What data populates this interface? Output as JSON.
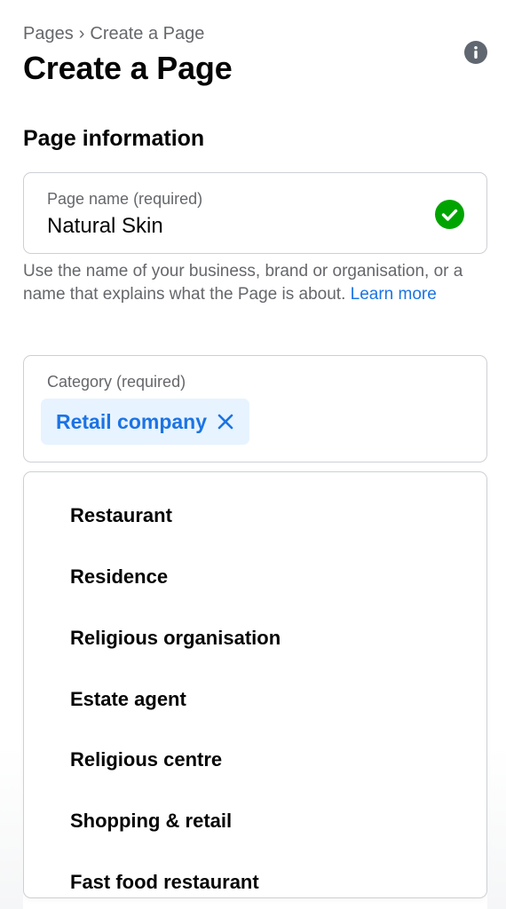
{
  "header": {
    "breadcrumb_root": "Pages",
    "breadcrumb_separator": "›",
    "breadcrumb_current": "Create a Page",
    "title": "Create a Page",
    "info_icon": "info-icon"
  },
  "section": {
    "title": "Page information"
  },
  "page_name": {
    "label": "Page name (required)",
    "value": "Natural Skin",
    "status_icon": "check-circle-icon",
    "status_color": "#00a400"
  },
  "helper": {
    "text": "Use the name of your business, brand or organisation, or a name that explains what the Page is about. ",
    "link": "Learn more"
  },
  "category": {
    "label": "Category (required)",
    "selected_chip": "Retail company",
    "remove_icon": "close-icon"
  },
  "dropdown": {
    "options": [
      "Restaurant",
      "Residence",
      "Religious organisation",
      "Estate agent",
      "Religious centre",
      "Shopping & retail",
      "Fast food restaurant"
    ]
  },
  "colors": {
    "accent": "#1b74e4",
    "chip_background": "#e7f3ff",
    "secondary_text": "#65676b",
    "border": "#ccd0d5"
  }
}
